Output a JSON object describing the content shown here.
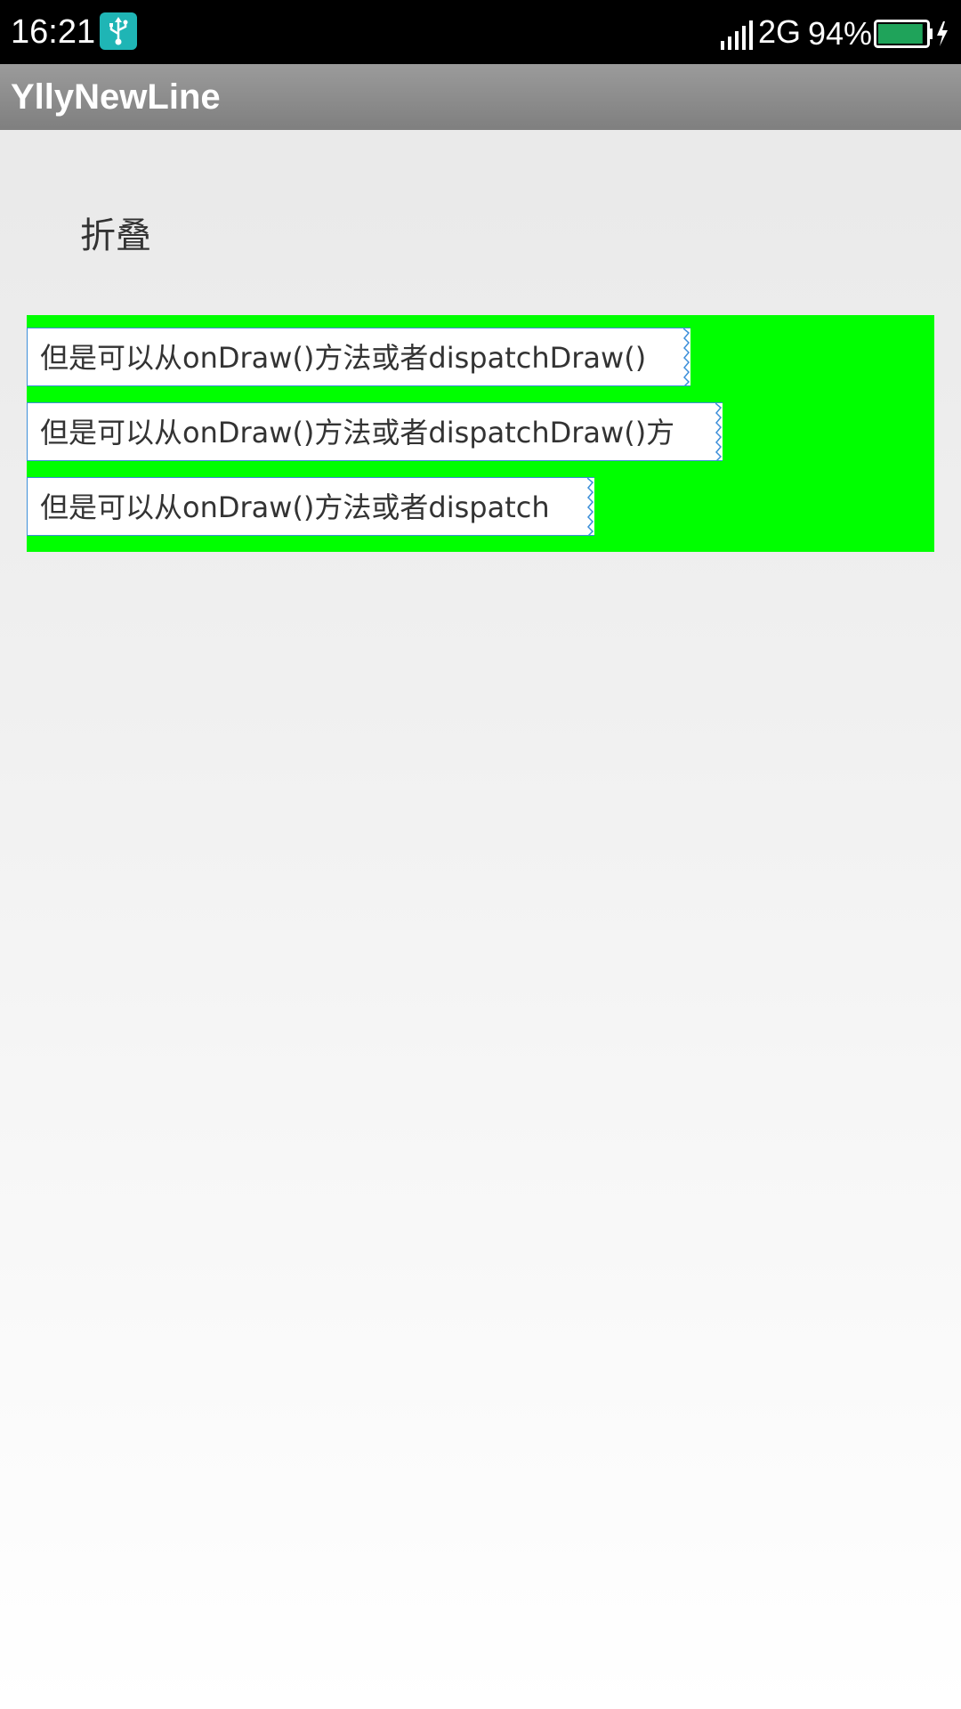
{
  "status_bar": {
    "time": "16:21",
    "network": "2G",
    "battery_percent": "94%",
    "battery_level": 0.94,
    "icons": [
      "usb-icon",
      "signal-icon",
      "battery-icon",
      "charging-icon"
    ]
  },
  "action_bar": {
    "title": "YllyNewLine"
  },
  "toggle": {
    "label": "折叠"
  },
  "flow_layout": {
    "background": "#00ff00",
    "border_color": "#3d8fd9",
    "items": [
      {
        "text": "但是可以从onDraw()方法或者dispatchDraw()"
      },
      {
        "text": "但是可以从onDraw()方法或者dispatchDraw()方"
      },
      {
        "text": "但是可以从onDraw()方法或者dispatch"
      }
    ]
  }
}
